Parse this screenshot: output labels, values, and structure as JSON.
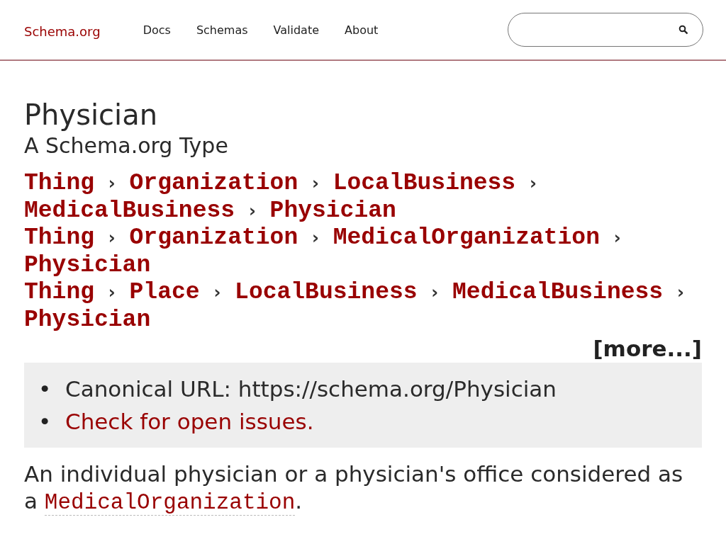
{
  "header": {
    "logo": "Schema.org",
    "nav": [
      "Docs",
      "Schemas",
      "Validate",
      "About"
    ]
  },
  "title": "Physician",
  "subtitle": "A Schema.org Type",
  "separator": "›",
  "breadcrumbs": [
    [
      "Thing",
      "Organization",
      "LocalBusiness",
      "MedicalBusiness",
      "Physician"
    ],
    [
      "Thing",
      "Organization",
      "MedicalOrganization",
      "Physician"
    ],
    [
      "Thing",
      "Place",
      "LocalBusiness",
      "MedicalBusiness",
      "Physician"
    ]
  ],
  "more": "[more...]",
  "info": [
    {
      "kind": "text",
      "bullet": "•",
      "text": "Canonical URL: https://schema.org/Physician"
    },
    {
      "kind": "link",
      "bullet": "•",
      "text": "Check for open issues."
    }
  ],
  "description": {
    "before": "An individual physician or a physician's office considered as a ",
    "link": "MedicalOrganization",
    "after": "."
  }
}
